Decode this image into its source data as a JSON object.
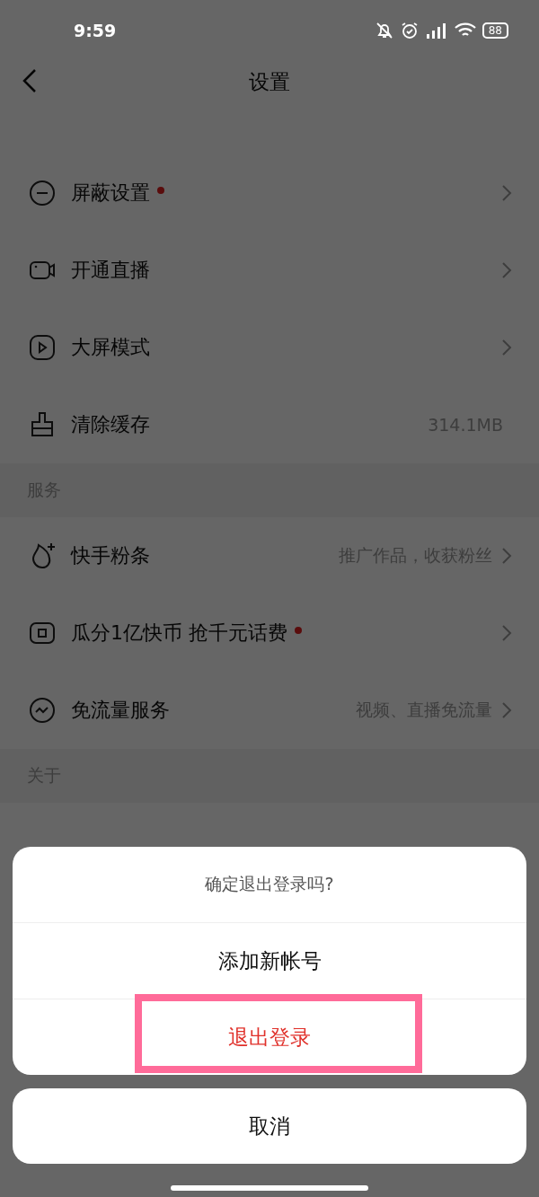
{
  "status_bar": {
    "time": "9:59",
    "battery": "88"
  },
  "header": {
    "title": "设置"
  },
  "sections": [
    {
      "items": [
        {
          "label": "屏蔽设置",
          "badge": true,
          "chevron": true
        },
        {
          "label": "开通直播",
          "badge": false,
          "chevron": true
        },
        {
          "label": "大屏模式",
          "badge": false,
          "chevron": true
        },
        {
          "label": "清除缓存",
          "badge": false,
          "value": "314.1MB",
          "chevron": false
        }
      ]
    },
    {
      "title": "服务",
      "items": [
        {
          "label": "快手粉条",
          "badge": false,
          "value": "推广作品，收获粉丝",
          "chevron": true
        },
        {
          "label": "瓜分1亿快币 抢千元话费",
          "badge": true,
          "chevron": true
        },
        {
          "label": "免流量服务",
          "badge": false,
          "value": "视频、直播免流量",
          "chevron": true
        }
      ]
    },
    {
      "title": "关于"
    }
  ],
  "sheet": {
    "title": "确定退出登录吗?",
    "options": [
      {
        "label": "添加新帐号",
        "kind": "normal",
        "highlighted": false
      },
      {
        "label": "退出登录",
        "kind": "danger",
        "highlighted": true
      }
    ],
    "cancel": "取消"
  }
}
